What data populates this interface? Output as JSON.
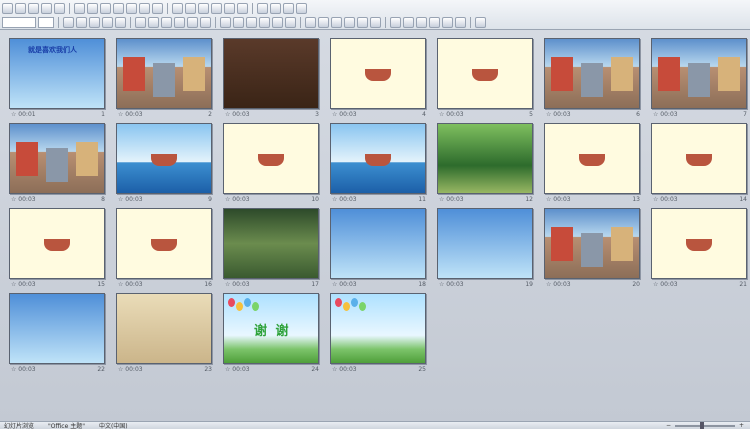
{
  "toolbar": {
    "row1_buttons": 22,
    "row2_buttons": 30
  },
  "slides": [
    {
      "time": "00:01",
      "num": "1",
      "theme": "sky",
      "title": "就是喜欢我们人"
    },
    {
      "time": "00:03",
      "num": "2",
      "theme": "street"
    },
    {
      "time": "00:03",
      "num": "3",
      "theme": "room"
    },
    {
      "time": "00:03",
      "num": "4",
      "theme": "cream"
    },
    {
      "time": "00:03",
      "num": "5",
      "theme": "cream"
    },
    {
      "time": "00:03",
      "num": "6",
      "theme": "street"
    },
    {
      "time": "00:03",
      "num": "7",
      "theme": "street"
    },
    {
      "time": "00:03",
      "num": "8",
      "theme": "street"
    },
    {
      "time": "00:03",
      "num": "9",
      "theme": "sea"
    },
    {
      "time": "00:03",
      "num": "10",
      "theme": "cream"
    },
    {
      "time": "00:03",
      "num": "11",
      "theme": "sea"
    },
    {
      "time": "00:03",
      "num": "12",
      "theme": "jungle"
    },
    {
      "time": "00:03",
      "num": "13",
      "theme": "cream"
    },
    {
      "time": "00:03",
      "num": "14",
      "theme": "cream"
    },
    {
      "time": "00:03",
      "num": "15",
      "theme": "cream"
    },
    {
      "time": "00:03",
      "num": "16",
      "theme": "cream"
    },
    {
      "time": "00:03",
      "num": "17",
      "theme": "forest"
    },
    {
      "time": "00:03",
      "num": "18",
      "theme": "sky"
    },
    {
      "time": "00:03",
      "num": "19",
      "theme": "sky"
    },
    {
      "time": "00:03",
      "num": "20",
      "theme": "street"
    },
    {
      "time": "00:03",
      "num": "21",
      "theme": "cream"
    },
    {
      "time": "00:03",
      "num": "22",
      "theme": "sky"
    },
    {
      "time": "00:03",
      "num": "23",
      "theme": "wall"
    },
    {
      "time": "00:03",
      "num": "24",
      "theme": "party",
      "title": "谢 谢"
    },
    {
      "time": "00:03",
      "num": "25",
      "theme": "party"
    }
  ],
  "status": {
    "view": "幻灯片浏览",
    "theme_name": "\"Office 主题\"",
    "language": "中文(中国)"
  },
  "zoom": {
    "level": 0.45
  }
}
